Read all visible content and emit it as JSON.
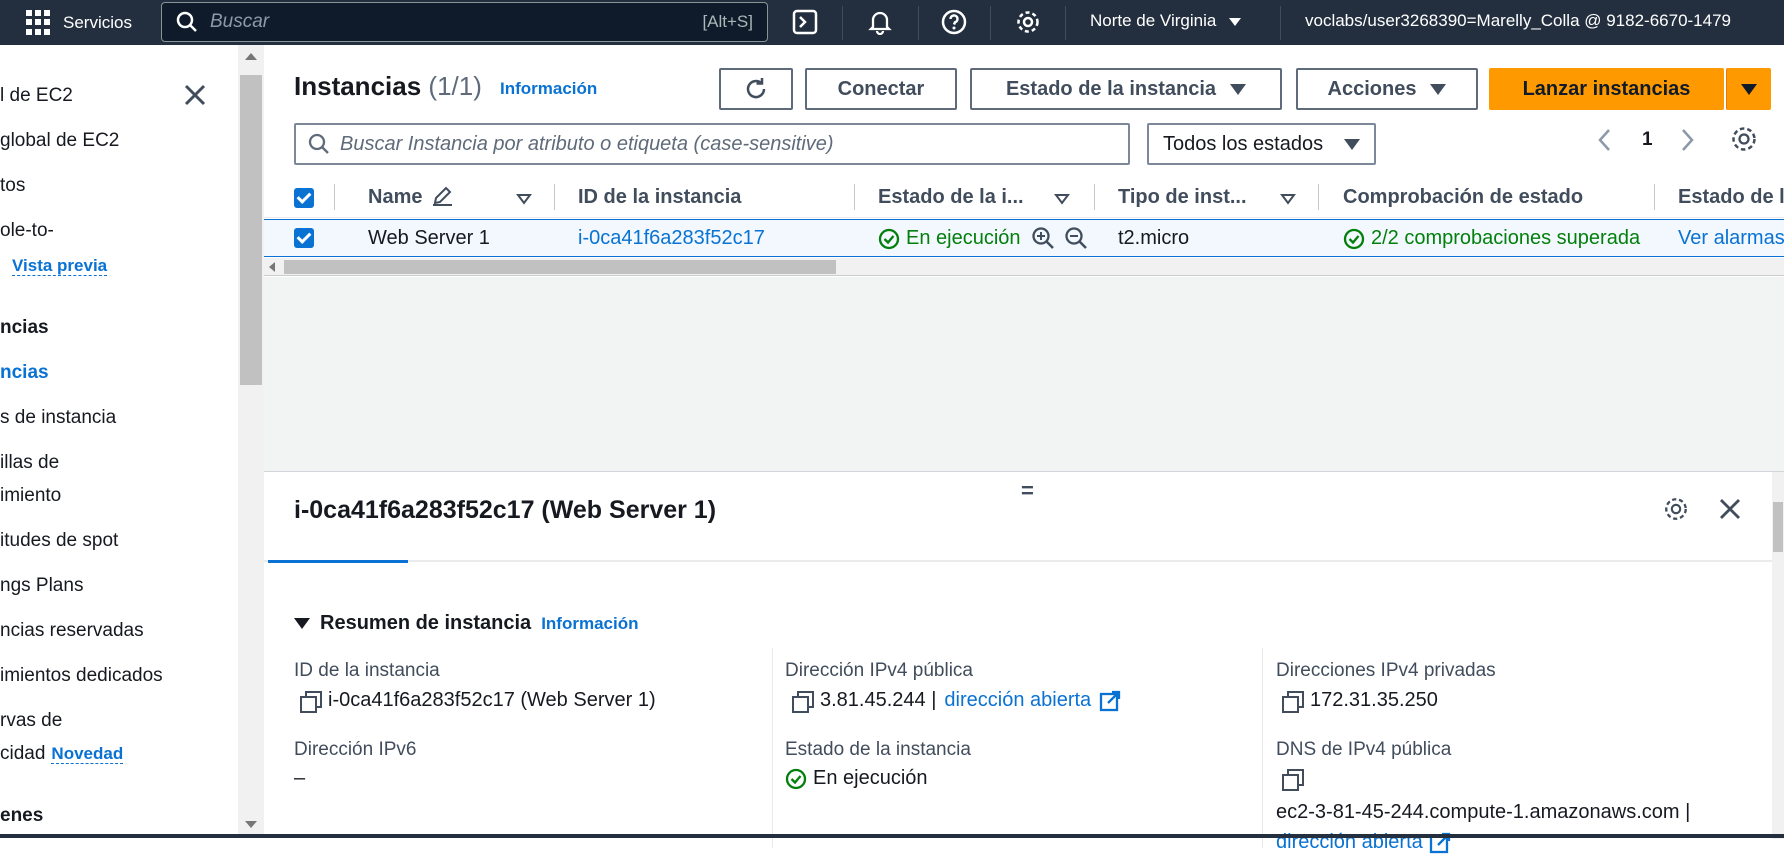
{
  "topnav": {
    "services_label": "Servicios",
    "search_placeholder": "Buscar",
    "search_shortcut": "[Alt+S]",
    "region": "Norte de Virginia",
    "account": "voclabs/user3268390=Marelly_Colla @ 9182-6670-1479"
  },
  "sidebar": {
    "items": [
      {
        "label": "l de EC2"
      },
      {
        "label": " global de EC2"
      },
      {
        "label": "tos"
      },
      {
        "label": "ole-to-"
      },
      {
        "label": "Vista previa"
      },
      {
        "label": "ncias"
      },
      {
        "label": "ncias"
      },
      {
        "label": "s de instancia"
      },
      {
        "label": "illas de"
      },
      {
        "label": "imiento"
      },
      {
        "label": "itudes de spot"
      },
      {
        "label": "ngs Plans"
      },
      {
        "label": "ncias reservadas"
      },
      {
        "label": "imientos dedicados"
      },
      {
        "label": "rvas de"
      },
      {
        "label": "cidad"
      },
      {
        "label": "Novedad"
      },
      {
        "label": "enes"
      }
    ]
  },
  "header": {
    "title": "Instancias",
    "count": "(1/1)",
    "info_label": "Información",
    "connect_label": "Conectar",
    "state_label": "Estado de la instancia",
    "actions_label": "Acciones",
    "launch_label": "Lanzar instancias",
    "search_placeholder": "Buscar Instancia por atributo o etiqueta (case-sensitive)",
    "filter_value": "Todos los estados",
    "page_number": "1"
  },
  "table": {
    "columns": [
      "Name",
      "ID de la instancia",
      "Estado de la i...",
      "Tipo de inst...",
      "Comprobación de estado",
      "Estado de l"
    ],
    "rows": [
      {
        "name": "Web Server 1",
        "id": "i-0ca41f6a283f52c17",
        "state": "En ejecución",
        "type": "t2.micro",
        "check": "2/2 comprobaciones superada",
        "alarms": "Ver alarmas"
      }
    ]
  },
  "detail": {
    "title": "i-0ca41f6a283f52c17 (Web Server 1)",
    "section_title": "Resumen de instancia",
    "section_info": "Información",
    "fields": {
      "instance_id_label": "ID de la instancia",
      "instance_id_value": "i-0ca41f6a283f52c17 (Web Server 1)",
      "public_ipv4_label": "Dirección IPv4 pública",
      "public_ipv4_value": "3.81.45.244 |",
      "open_address": "dirección abierta",
      "private_ipv4_label": "Direcciones IPv4 privadas",
      "private_ipv4_value": "172.31.35.250",
      "ipv6_label": "Dirección IPv6",
      "ipv6_value": "–",
      "state_label": "Estado de la instancia",
      "state_value": "En ejecución",
      "public_dns_label": "DNS de IPv4 pública",
      "public_dns_value": "ec2-3-81-45-244.compute-1.amazonaws.com |",
      "dns_open_address": "dirección abierta"
    }
  },
  "colors": {
    "nav_bg": "#232f3e",
    "link": "#0972d3",
    "primary": "#ff9900",
    "success": "#037f0c"
  }
}
